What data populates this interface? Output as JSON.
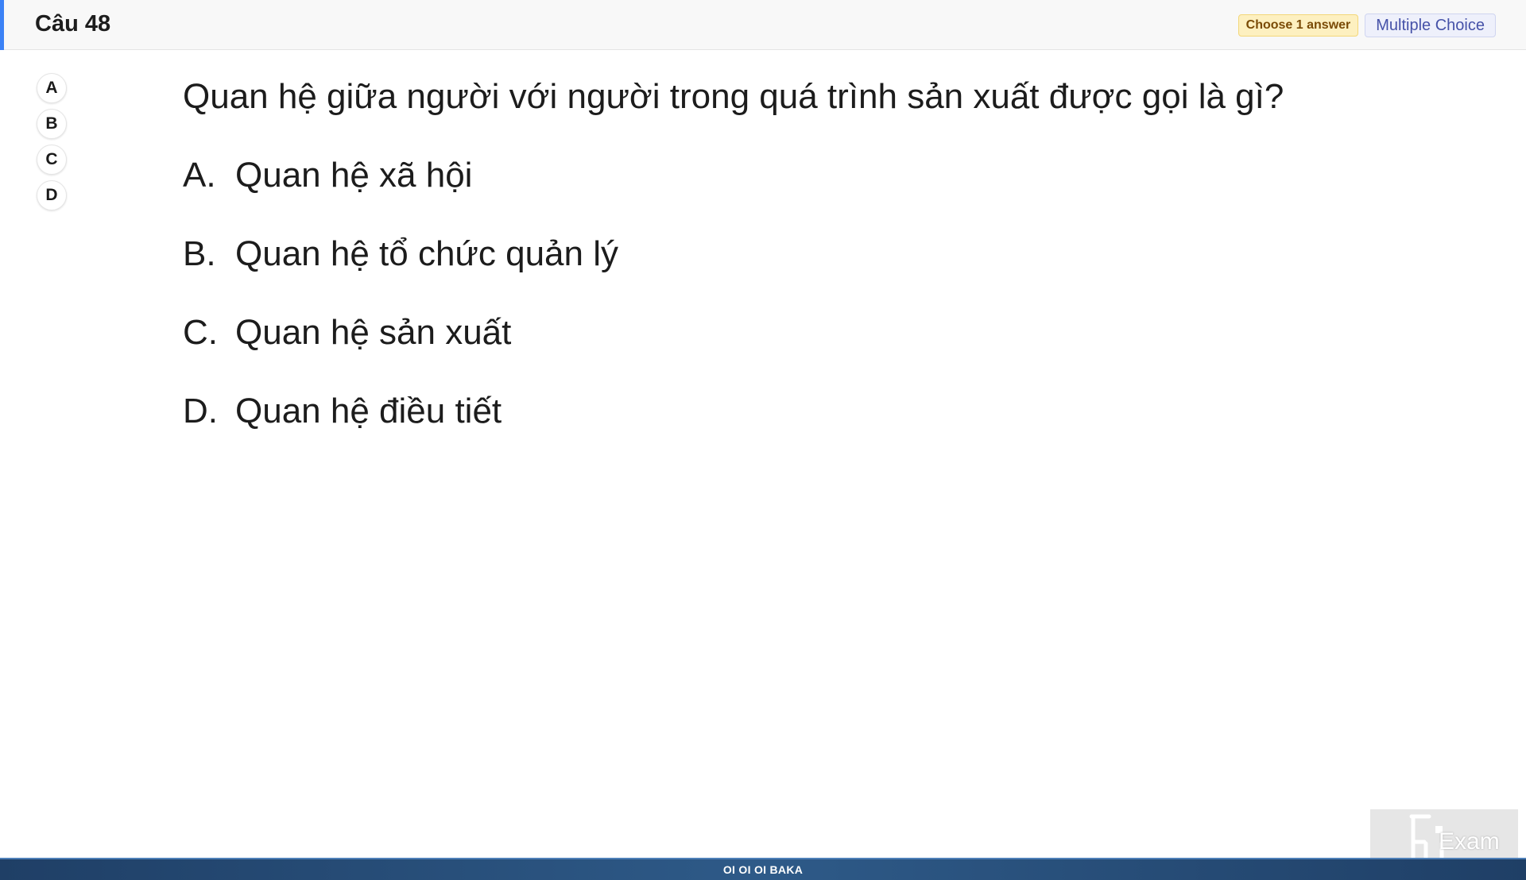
{
  "header": {
    "title": "Câu 48",
    "badge_choose": "Choose 1 answer",
    "badge_type": "Multiple Choice",
    "accent_color": "#3b82f6"
  },
  "selectors": [
    "A",
    "B",
    "C",
    "D"
  ],
  "question": {
    "text": "Quan hệ giữa người với người trong quá trình sản xuất được gọi là gì?",
    "options": [
      {
        "letter": "A.",
        "text": "Quan hệ xã hội"
      },
      {
        "letter": "B.",
        "text": "Quan hệ tổ chức quản lý"
      },
      {
        "letter": "C.",
        "text": "Quan hệ sản xuất"
      },
      {
        "letter": "D.",
        "text": "Quan hệ điều tiết"
      }
    ]
  },
  "footer": {
    "text": "OI OI OI BAKA"
  },
  "watermark": {
    "logo_icon": "fu-logo-icon",
    "text": "Exam"
  }
}
